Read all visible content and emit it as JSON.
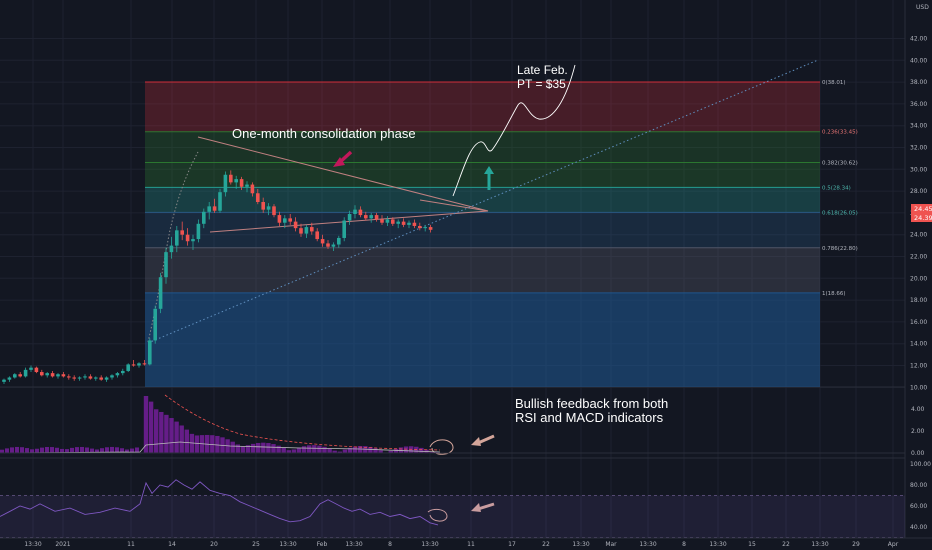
{
  "currency_label": "USD",
  "price_axis_ticks": [
    "42.00",
    "40.00",
    "38.00",
    "36.00",
    "34.00",
    "32.00",
    "30.00",
    "28.00",
    "26.00",
    "24.00",
    "22.00",
    "20.00",
    "18.00",
    "16.00",
    "14.00",
    "12.00",
    "10.00"
  ],
  "macd_axis_ticks": [
    "4.00",
    "2.00",
    "0.00"
  ],
  "rsi_axis_ticks": [
    "100.00",
    "80.00",
    "60.00",
    "40.00"
  ],
  "price_badges": {
    "last": "24.45",
    "close": "24.39"
  },
  "time_axis_labels": [
    "13:30",
    "2021",
    "11",
    "14",
    "20",
    "25",
    "13:30",
    "Feb",
    "13:30",
    "8",
    "13:30",
    "11",
    "17",
    "22",
    "13:30",
    "Mar",
    "13:30",
    "8",
    "13:30",
    "15",
    "22",
    "13:30",
    "29",
    "Apr"
  ],
  "fib_levels": [
    {
      "label": "0(38.01)",
      "value": 38.01,
      "fill": "#e0303a",
      "alpha": 0.25
    },
    {
      "label": "0.236(33.45)",
      "value": 33.45,
      "fill": "#2e7d32",
      "alpha": 0.28,
      "label_color": "#e57373"
    },
    {
      "label": "0.382(30.62)",
      "value": 30.62,
      "fill": "#2e7d32",
      "alpha": 0.32
    },
    {
      "label": "0.5(28.34)",
      "value": 28.34,
      "fill": "#26a69a",
      "alpha": 0.28,
      "label_color": "#4db6ac"
    },
    {
      "label": "0.618(26.05)",
      "value": 26.05,
      "fill": "#2a5c8a",
      "alpha": 0.28,
      "label_color": "#4db6ac"
    },
    {
      "label": "0.786(22.80)",
      "value": 22.8,
      "fill": "#555a6a",
      "alpha": 0.35
    },
    {
      "label": "1(18.66)",
      "value": 18.66,
      "fill": "#1f5a96",
      "alpha": 0.55
    }
  ],
  "annotations": {
    "consolidation": "One-month consolidation phase",
    "target_line1": "Late Feb.",
    "target_line2": "PT = $35",
    "bullish_line1": "Bullish feedback from both",
    "bullish_line2": "RSI and MACD indicators"
  },
  "colors": {
    "background": "#131722",
    "up": "#26a69a",
    "down": "#ef5350",
    "macd_hist": "#7b1fa2",
    "rsi": "#7e57c2",
    "annotation_arrow_pink": "#c2185b",
    "annotation_arrow_green": "#26a69a",
    "annotation_arrow_tan": "#d4a59a"
  },
  "chart_data": {
    "type": "candlestick",
    "currency": "USD",
    "ylim": [
      8.5,
      43
    ],
    "candles": [
      [
        10.5,
        10.8,
        10.3,
        10.7
      ],
      [
        10.7,
        11.0,
        10.5,
        10.9
      ],
      [
        10.9,
        11.3,
        10.8,
        11.2
      ],
      [
        11.2,
        11.4,
        10.9,
        11.0
      ],
      [
        11.0,
        11.8,
        10.9,
        11.6
      ],
      [
        11.6,
        12.0,
        11.4,
        11.8
      ],
      [
        11.8,
        11.9,
        11.3,
        11.4
      ],
      [
        11.4,
        11.6,
        11.0,
        11.1
      ],
      [
        11.1,
        11.4,
        10.9,
        11.3
      ],
      [
        11.3,
        11.5,
        10.9,
        11.0
      ],
      [
        11.0,
        11.3,
        10.8,
        11.2
      ],
      [
        11.2,
        11.4,
        10.9,
        11.0
      ],
      [
        11.0,
        11.2,
        10.7,
        10.9
      ],
      [
        10.9,
        11.1,
        10.6,
        10.8
      ],
      [
        10.8,
        11.0,
        10.6,
        10.9
      ],
      [
        10.9,
        11.2,
        10.7,
        11.0
      ],
      [
        11.0,
        11.2,
        10.7,
        10.8
      ],
      [
        10.8,
        11.0,
        10.6,
        10.9
      ],
      [
        10.9,
        11.1,
        10.6,
        10.7
      ],
      [
        10.7,
        11.0,
        10.5,
        10.9
      ],
      [
        10.9,
        11.2,
        10.7,
        11.1
      ],
      [
        11.1,
        11.4,
        10.9,
        11.3
      ],
      [
        11.3,
        11.7,
        11.1,
        11.5
      ],
      [
        11.5,
        12.2,
        11.4,
        12.1
      ],
      [
        12.1,
        12.5,
        11.9,
        12.0
      ],
      [
        12.0,
        12.3,
        11.8,
        12.2
      ],
      [
        12.2,
        12.5,
        12.0,
        12.1
      ],
      [
        12.1,
        14.5,
        12.0,
        14.3
      ],
      [
        14.3,
        17.5,
        14.0,
        17.2
      ],
      [
        17.2,
        20.5,
        16.8,
        20.1
      ],
      [
        20.1,
        22.8,
        19.5,
        22.4
      ],
      [
        22.4,
        23.8,
        21.8,
        23.0
      ],
      [
        23.0,
        24.8,
        22.4,
        24.4
      ],
      [
        24.4,
        25.2,
        23.5,
        24.0
      ],
      [
        24.0,
        24.6,
        23.0,
        23.4
      ],
      [
        23.4,
        24.0,
        22.6,
        23.6
      ],
      [
        23.6,
        25.4,
        23.3,
        25.0
      ],
      [
        25.0,
        26.4,
        24.6,
        26.1
      ],
      [
        26.1,
        27.0,
        25.4,
        26.6
      ],
      [
        26.6,
        27.3,
        26.0,
        26.2
      ],
      [
        26.2,
        28.2,
        26.0,
        27.9
      ],
      [
        27.9,
        29.8,
        27.5,
        29.5
      ],
      [
        29.5,
        29.9,
        28.6,
        28.8
      ],
      [
        28.8,
        29.4,
        28.2,
        29.1
      ],
      [
        29.1,
        29.3,
        28.1,
        28.4
      ],
      [
        28.4,
        28.9,
        27.9,
        28.6
      ],
      [
        28.6,
        28.8,
        27.5,
        27.8
      ],
      [
        27.8,
        28.2,
        26.8,
        27.0
      ],
      [
        27.0,
        27.4,
        26.0,
        26.3
      ],
      [
        26.3,
        26.9,
        25.8,
        26.6
      ],
      [
        26.6,
        26.8,
        25.6,
        25.8
      ],
      [
        25.8,
        26.1,
        24.8,
        25.1
      ],
      [
        25.1,
        25.8,
        24.6,
        25.5
      ],
      [
        25.5,
        25.9,
        24.9,
        25.2
      ],
      [
        25.2,
        25.6,
        24.3,
        24.6
      ],
      [
        24.6,
        25.0,
        23.8,
        24.1
      ],
      [
        24.1,
        24.9,
        23.7,
        24.7
      ],
      [
        24.7,
        25.1,
        24.0,
        24.3
      ],
      [
        24.3,
        24.6,
        23.4,
        23.6
      ],
      [
        23.6,
        24.0,
        22.9,
        23.2
      ],
      [
        23.2,
        23.5,
        22.7,
        22.9
      ],
      [
        22.9,
        23.3,
        22.5,
        23.1
      ],
      [
        23.1,
        23.9,
        22.8,
        23.7
      ],
      [
        23.7,
        25.6,
        23.4,
        25.3
      ],
      [
        25.3,
        26.2,
        24.9,
        25.9
      ],
      [
        25.9,
        26.7,
        25.5,
        26.3
      ],
      [
        26.3,
        26.6,
        25.6,
        25.8
      ],
      [
        25.8,
        26.1,
        25.3,
        25.5
      ],
      [
        25.5,
        26.0,
        25.1,
        25.8
      ],
      [
        25.8,
        26.0,
        25.2,
        25.4
      ],
      [
        25.4,
        25.8,
        24.9,
        25.1
      ],
      [
        25.1,
        25.7,
        24.8,
        25.4
      ],
      [
        25.4,
        25.6,
        24.8,
        25.0
      ],
      [
        25.0,
        25.4,
        24.6,
        25.2
      ],
      [
        25.2,
        25.5,
        24.7,
        24.9
      ],
      [
        24.9,
        25.3,
        24.6,
        25.1
      ],
      [
        25.1,
        25.4,
        24.6,
        24.8
      ],
      [
        24.8,
        25.1,
        24.4,
        24.6
      ],
      [
        24.6,
        24.9,
        24.3,
        24.7
      ],
      [
        24.7,
        24.9,
        24.2,
        24.45
      ]
    ]
  }
}
